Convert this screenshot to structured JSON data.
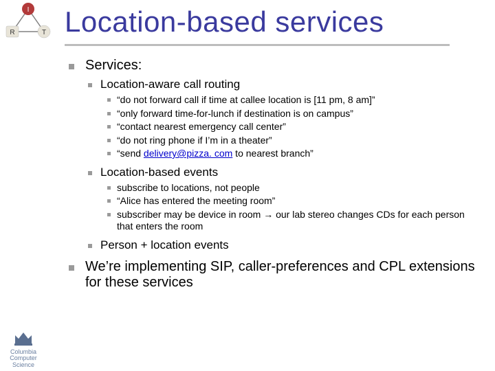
{
  "title": "Location-based services",
  "corner": {
    "i": "I",
    "r": "R",
    "t": "T"
  },
  "services": {
    "heading": "Services:",
    "routing": {
      "label": "Location-aware call routing",
      "items": [
        "“do not forward call if time at callee location is [11 pm, 8 am]”",
        "“only forward time-for-lunch if destination is on campus”",
        "“contact nearest emergency call center”",
        "“do not ring phone if I’m in a theater”"
      ],
      "email_item": {
        "prefix": "“send ",
        "email": "delivery@pizza. com",
        "suffix": " to nearest branch”"
      }
    },
    "events": {
      "label": "Location-based events",
      "items": [
        "subscribe to locations, not people",
        "“Alice has entered the meeting room”",
        "subscriber may be device in room → our lab stereo changes CDs for each person that enters the room"
      ]
    },
    "person_loc": "Person + location events"
  },
  "implement": "We’re implementing SIP, caller-preferences and CPL extensions for these services",
  "logo": {
    "line1": "Columbia",
    "line2": "Computer",
    "line3": "Science"
  }
}
